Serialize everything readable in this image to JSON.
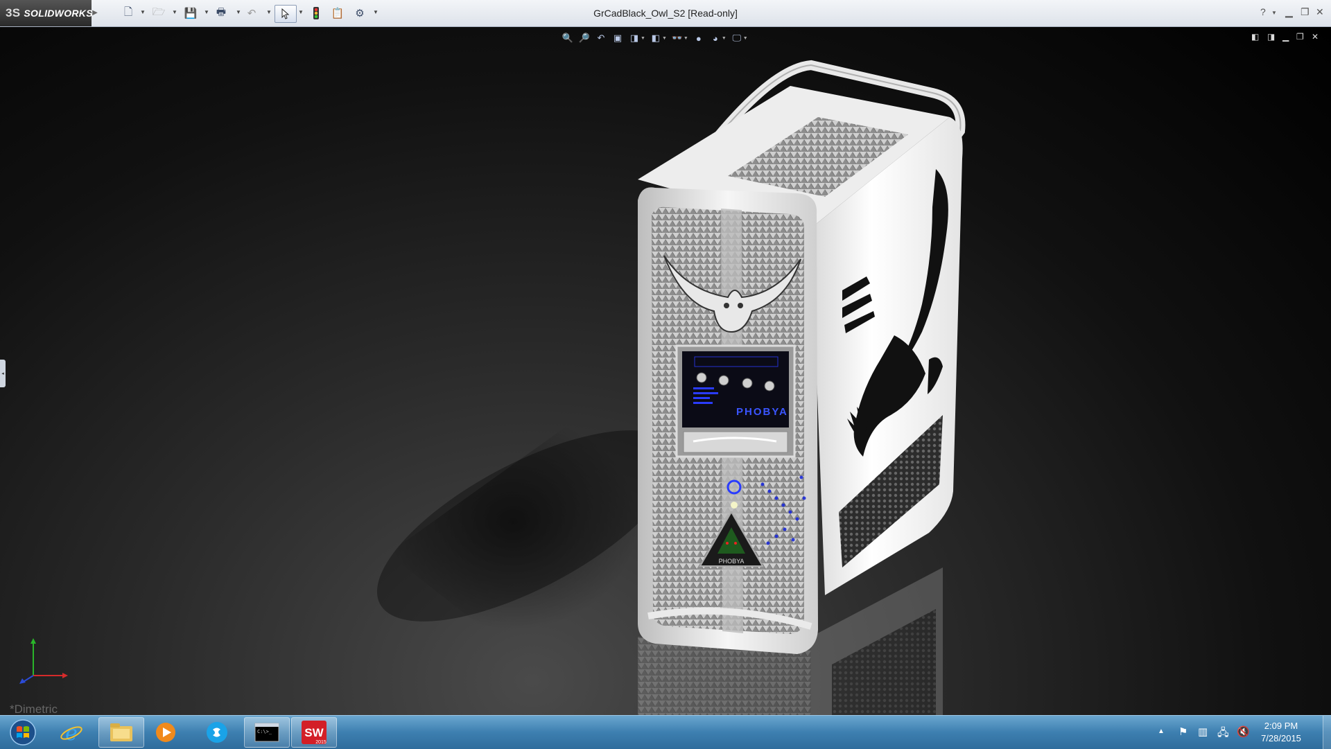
{
  "app": {
    "brand": "SOLIDWORKS",
    "brand_mark": "3S",
    "window_title": "GrCadBlack_Owl_S2 [Read-only]"
  },
  "toolbar": {
    "new_icon": "new-document-icon",
    "open_icon": "open-folder-icon",
    "save_icon": "save-icon",
    "print_icon": "print-icon",
    "undo_icon": "undo-icon",
    "select_icon": "select-arrow-icon",
    "rebuild_icon": "rebuild-traffic-light-icon",
    "file_properties_icon": "file-properties-icon",
    "options_icon": "options-icon",
    "help_icon": "help-icon"
  },
  "viewport": {
    "view_name": "*Dimetric",
    "model_labels": {
      "panel_brand": "PHOBYA",
      "badge_brand": "PHOBYA"
    },
    "hud_icons": [
      "zoom-to-fit-icon",
      "zoom-to-area-icon",
      "previous-view-icon",
      "section-view-icon",
      "view-orientation-icon",
      "display-style-icon",
      "hide-show-items-icon",
      "edit-appearance-icon",
      "apply-scene-icon",
      "view-settings-icon"
    ]
  },
  "taskbar": {
    "clock_time": "2:09 PM",
    "clock_date": "7/28/2015",
    "apps": [
      "internet-explorer-icon",
      "file-explorer-icon",
      "media-player-icon",
      "skype-icon",
      "command-prompt-icon",
      "solidworks-2015-icon"
    ],
    "solidworks_badge": "SW",
    "solidworks_year": "2015",
    "cmd_label": "C:\\>_"
  },
  "colors": {
    "titlebar": "#e6eaf0",
    "taskbar": "#3d7fb0",
    "accent_blue": "#2a3cff",
    "model_white": "#f2f2f2"
  }
}
